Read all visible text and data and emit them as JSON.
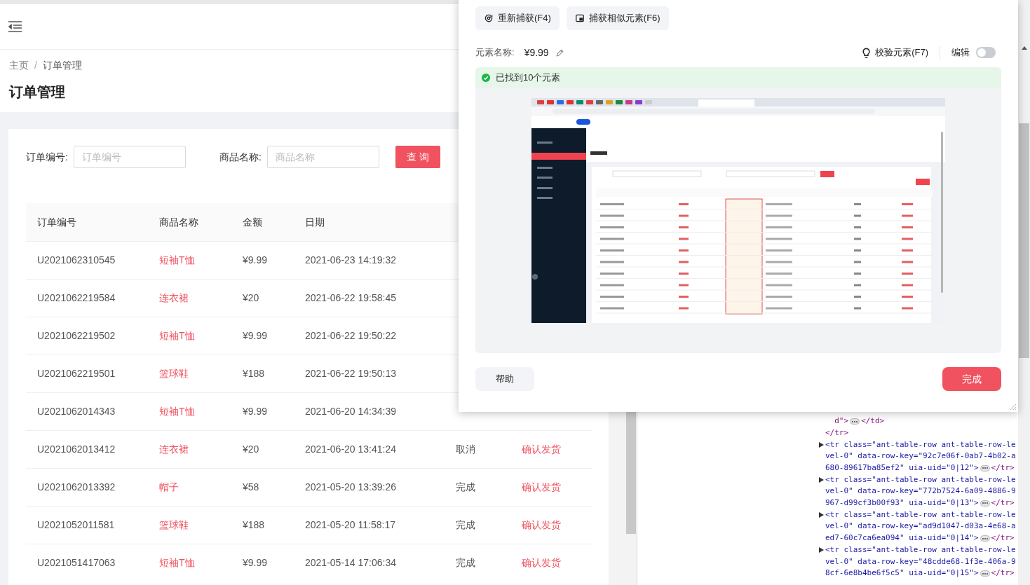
{
  "app": {
    "breadcrumb": [
      "主页",
      "/",
      "订单管理"
    ],
    "title": "订单管理",
    "search": [
      {
        "label": "订单编号:",
        "placeholder": "订单编号"
      },
      {
        "label": "商品名称:",
        "placeholder": "商品名称"
      }
    ],
    "query_button": "查 询",
    "table": {
      "columns": [
        "订单编号",
        "商品名称",
        "金额",
        "日期"
      ],
      "rows": [
        {
          "id": "U2021062310545",
          "product": "短袖T恤",
          "amount": "¥9.99",
          "date": "2021-06-23 14:19:32"
        },
        {
          "id": "U2021062219584",
          "product": "连衣裙",
          "amount": "¥20",
          "date": "2021-06-22 19:58:45"
        },
        {
          "id": "U2021062219502",
          "product": "短袖T恤",
          "amount": "¥9.99",
          "date": "2021-06-22 19:50:22"
        },
        {
          "id": "U2021062219501",
          "product": "篮球鞋",
          "amount": "¥188",
          "date": "2021-06-22 19:50:13"
        },
        {
          "id": "U2021062014343",
          "product": "短袖T恤",
          "amount": "¥9.99",
          "date": "2021-06-20 14:34:39"
        },
        {
          "id": "U2021062013412",
          "product": "连衣裙",
          "amount": "¥20",
          "date": "2021-06-20 13:41:24",
          "status": "取消",
          "action": "确认发货"
        },
        {
          "id": "U2021062013392",
          "product": "帽子",
          "amount": "¥58",
          "date": "2021-05-20 13:39:26",
          "status": "完成",
          "action": "确认发货"
        },
        {
          "id": "U2021052011581",
          "product": "篮球鞋",
          "amount": "¥188",
          "date": "2021-05-20 11:58:17",
          "status": "完成",
          "action": "确认发货"
        },
        {
          "id": "U2021051417063",
          "product": "短袖T恤",
          "amount": "¥9.99",
          "date": "2021-05-14 17:06:34",
          "status": "完成",
          "action": "确认发货"
        }
      ]
    }
  },
  "devtools": {
    "nodes": [
      {
        "expandable": false,
        "lines": [
          "  d\">"
        ],
        "collapsed": true,
        "closing": "</td>"
      },
      {
        "expandable": false,
        "lines": [
          "</tr>"
        ],
        "collapsed": false
      },
      {
        "expandable": true,
        "lines": [
          "<tr class=\"ant-table-row ant-table-row-le",
          "vel-0\" data-row-key=\"92c7e06f-0ab7-4b02-a",
          "680-89617ba85ef2\" uia-uid=\"0|12\">"
        ],
        "collapsed": true,
        "closing": "</tr>"
      },
      {
        "expandable": true,
        "lines": [
          "<tr class=\"ant-table-row ant-table-row-le",
          "vel-0\" data-row-key=\"772b7524-6a09-4886-9",
          "967-d99cf3b00f93\" uia-uid=\"0|13\">"
        ],
        "collapsed": true,
        "closing": "</tr>"
      },
      {
        "expandable": true,
        "lines": [
          "<tr class=\"ant-table-row ant-table-row-le",
          "vel-0\" data-row-key=\"ad9d1047-d03a-4e68-a",
          "ed7-60c7ca6ea094\" uia-uid=\"0|14\">"
        ],
        "collapsed": true,
        "closing": "</tr>"
      },
      {
        "expandable": true,
        "lines": [
          "<tr class=\"ant-table-row ant-table-row-le",
          "vel-0\" data-row-key=\"48cdde68-1f3e-406a-9",
          "8cf-6e8b4be6f5c5\" uia-uid=\"0|15\">"
        ],
        "collapsed": true,
        "closing": "</tr>"
      }
    ]
  },
  "dialog": {
    "actions": [
      {
        "kind": "recapture",
        "label": "重新捕获(F4)"
      },
      {
        "kind": "similar",
        "label": "捕获相似元素(F6)"
      }
    ],
    "element_name_label": "元素名称:",
    "element_name": "¥9.99",
    "verify": "校验元素(F7)",
    "edit_label": "编辑",
    "edit_on": false,
    "found": "已找到10个元素",
    "help": "帮助",
    "done": "完成"
  }
}
